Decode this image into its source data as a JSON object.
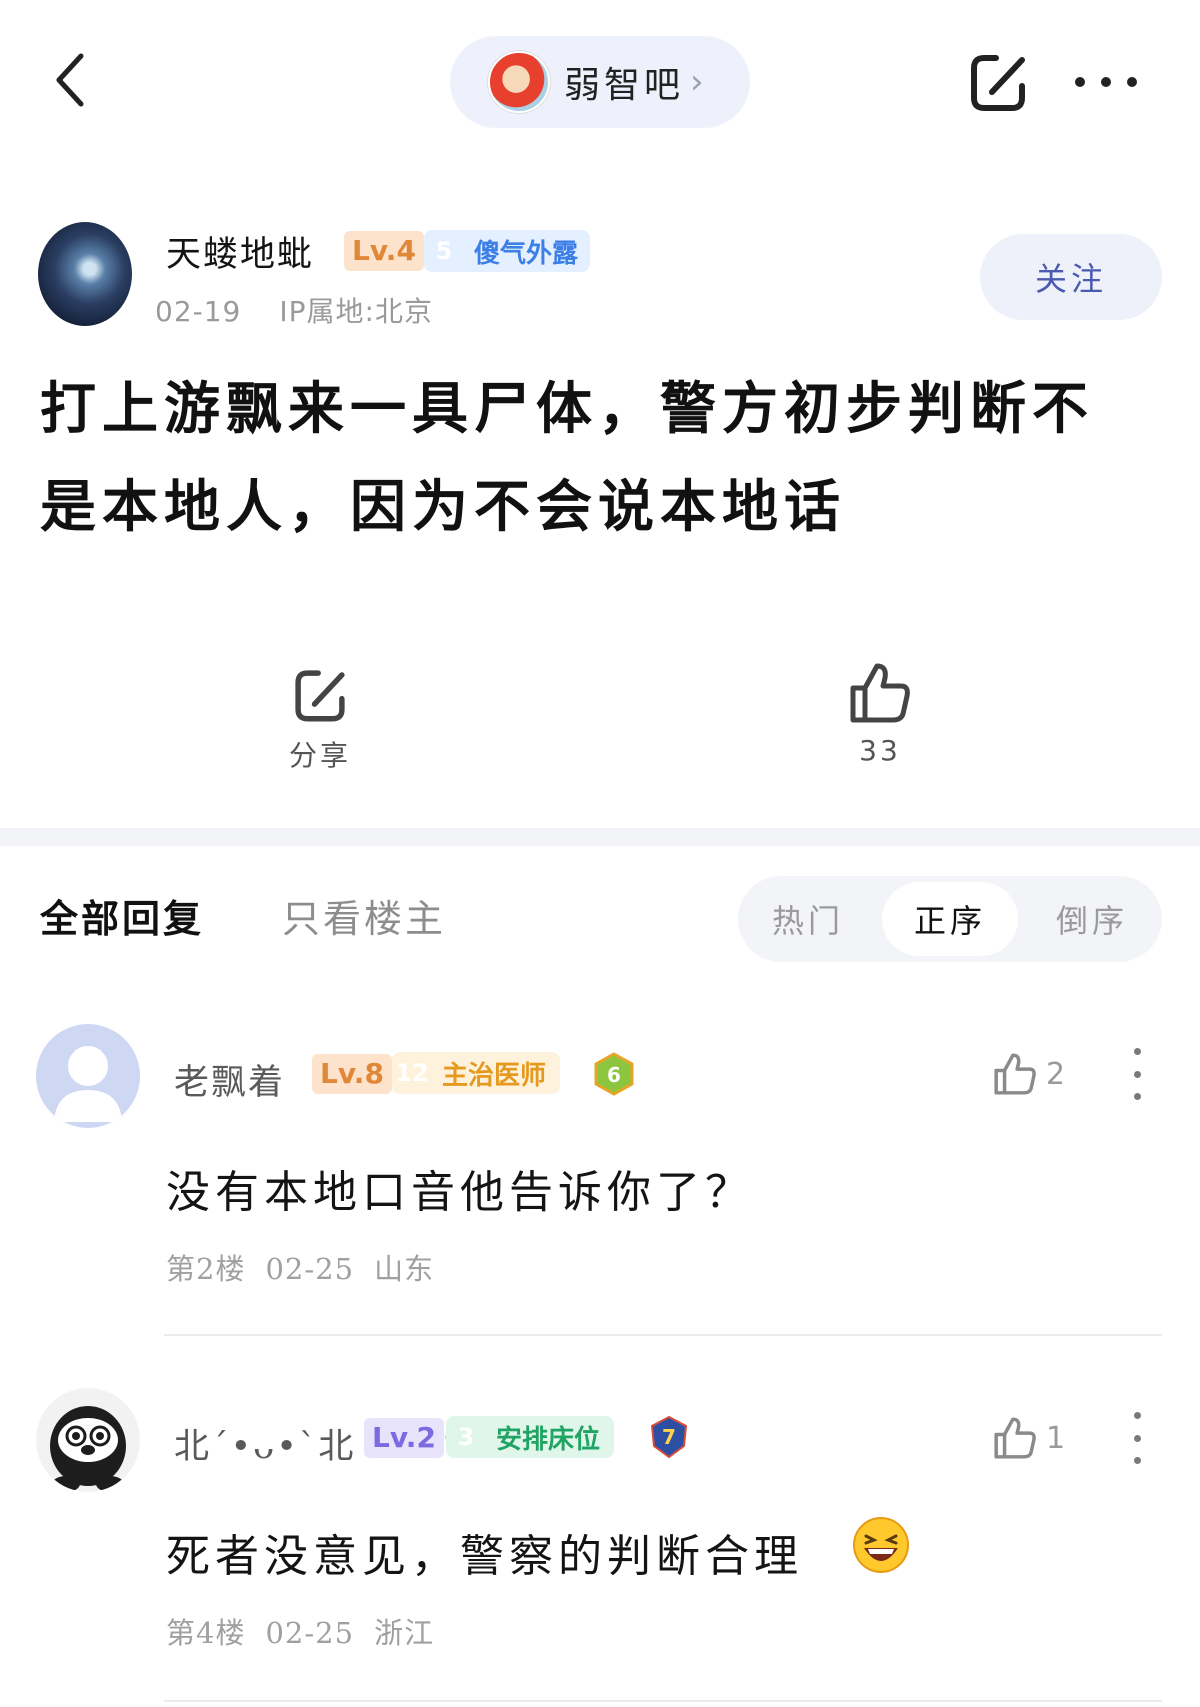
{
  "topbar": {
    "forum_name": "弱智吧",
    "chevron": "›"
  },
  "author": {
    "name": "天蝼地蚍",
    "level": "Lv.4",
    "title_rank": "5",
    "title_name": "傻气外露",
    "date": "02-19",
    "ip": "IP属地:北京",
    "follow_label": "关注"
  },
  "post": {
    "title": "打上游飘来一具尸体，警方初步判断不是本地人，因为不会说本地话"
  },
  "actions": {
    "share_label": "分享",
    "like_count": "33"
  },
  "tabs": {
    "all": "全部回复",
    "op_only": "只看楼主",
    "sort_hot": "热门",
    "sort_asc": "正序",
    "sort_desc": "倒序"
  },
  "comments": [
    {
      "name": "老飘着",
      "level": "Lv.8",
      "title_rank": "12",
      "title_name": "主治医师",
      "extra_badge": "6",
      "likes": "2",
      "text": "没有本地口音他告诉你了？",
      "floor": "第2楼",
      "date": "02-25",
      "location": "山东"
    },
    {
      "name": "北´•ᴗ•`北",
      "level": "Lv.2",
      "title_rank": "3",
      "title_name": "安排床位",
      "extra_badge": "7",
      "likes": "1",
      "text": "死者没意见，警察的判断合理",
      "floor": "第4楼",
      "date": "02-25",
      "location": "浙江"
    }
  ],
  "icons": {
    "back": "back-arrow-icon",
    "share": "share-icon",
    "more": "more-icon",
    "like": "thumbs-up-icon",
    "emoji": "laughing-emoji-icon"
  },
  "colors": {
    "accent": "#4a5ab0",
    "level_orange": "#e08838",
    "title_blue": "#3c7fe6",
    "title_orange": "#e59a1f",
    "title_green": "#20a463"
  }
}
